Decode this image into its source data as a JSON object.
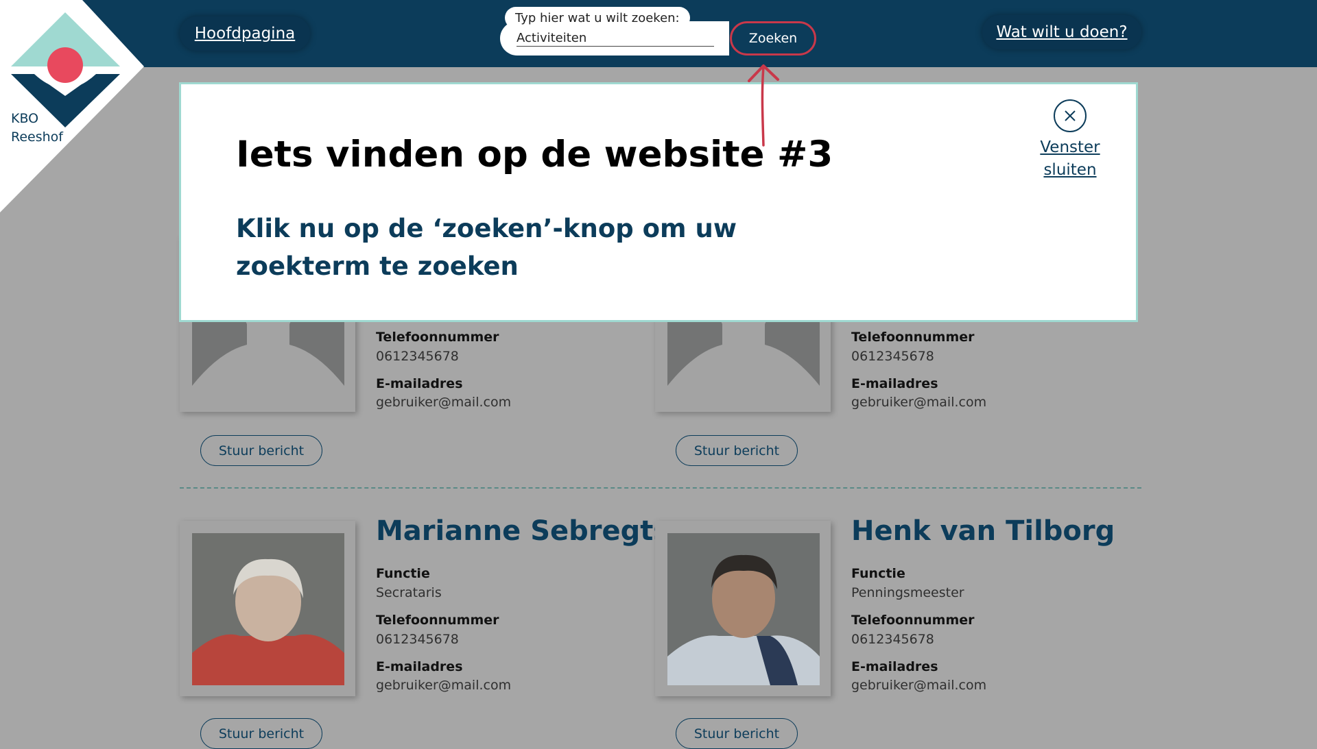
{
  "header": {
    "home_link": "Hoofdpagina",
    "what_link": "Wat wilt u doen?"
  },
  "logo": {
    "line1": "KBO",
    "line2": "Reeshof"
  },
  "search": {
    "label": "Typ hier wat u wilt zoeken:",
    "value": "Activiteiten",
    "button": "Zoeken"
  },
  "modal": {
    "title": "Iets vinden op de website #3",
    "instruction": "Klik nu op de ‘zoeken’-knop om uw zoekterm te zoeken",
    "close_label": "Venster sluiten"
  },
  "labels": {
    "function": "Functie",
    "phone": "Telefoonnummer",
    "email": "E-mailadres",
    "send_message": "Stuur bericht"
  },
  "members_top": [
    {
      "phone": "0612345678",
      "email": "gebruiker@mail.com"
    },
    {
      "phone": "0612345678",
      "email": "gebruiker@mail.com"
    }
  ],
  "members_bottom": [
    {
      "name": "Marianne Sebregts",
      "function": "Secrataris",
      "phone": "0612345678",
      "email": "gebruiker@mail.com"
    },
    {
      "name": "Henk van Tilborg",
      "function": "Penningsmeester",
      "phone": "0612345678",
      "email": "gebruiker@mail.com"
    }
  ],
  "colors": {
    "primary": "#0c3c5a",
    "accent_red": "#c9384a",
    "logo_mint": "#9fd9d1",
    "logo_dot": "#e8495e",
    "overlay_gray": "#a6a6a6"
  }
}
